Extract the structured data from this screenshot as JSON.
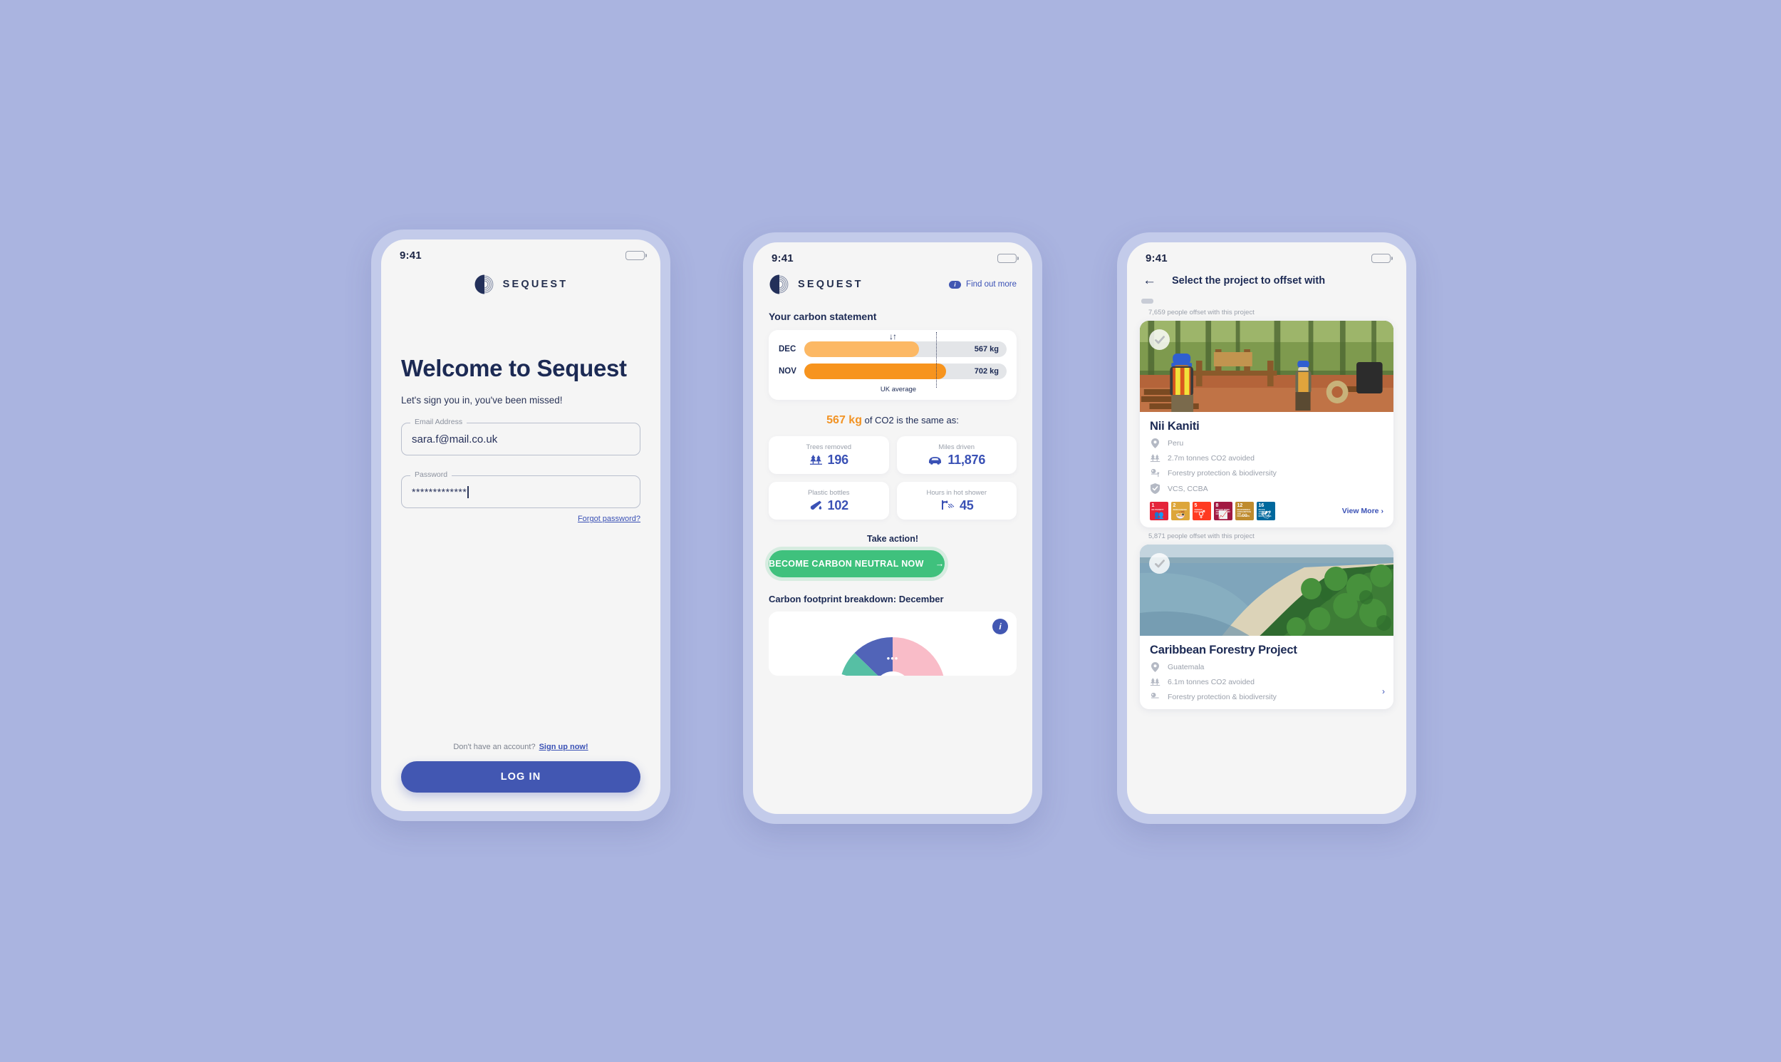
{
  "theme": {
    "background": "#aab4e0",
    "frame": "#c3cbea",
    "screen": "#f5f5f5",
    "navy": "#1c2a54",
    "blue": "#3a51b5",
    "button_blue": "#4257b2",
    "green": "#3fc17d",
    "orange_dark": "#f7941e",
    "orange_light": "#fcb864",
    "grey_track": "#e3e5e8",
    "muted": "#9aa0ab"
  },
  "brand": {
    "name": "SEQUEST"
  },
  "screen1": {
    "status": {
      "time": "9:41",
      "battery_icon": "battery-icon"
    },
    "title": "Welcome to Sequest",
    "subtitle": "Let's sign you in, you've been missed!",
    "email": {
      "label": "Email Address",
      "value": "sara.f@mail.co.uk",
      "placeholder": "Email Address"
    },
    "password": {
      "label": "Password",
      "value": "*************",
      "placeholder": "Password"
    },
    "forgot_label": "Forgot password?",
    "signup_prompt": "Don't have an account?",
    "signup_link": "Sign up now!",
    "login_label": "LOG IN"
  },
  "screen2": {
    "status": {
      "time": "9:41",
      "battery_icon": "battery-icon"
    },
    "find_out_more": "Find out more",
    "info_glyph": "i",
    "statement_title": "Your carbon statement",
    "sort_glyph": "↓↑",
    "average_label": "UK average",
    "equivalence_title_kg": "567 kg",
    "equivalence_title_rest": "of CO2 is the same as:",
    "equivalences": [
      {
        "label": "Trees removed",
        "value": "196",
        "icon": "trees-icon"
      },
      {
        "label": "Miles driven",
        "value": "11,876",
        "icon": "car-icon"
      },
      {
        "label": "Plastic bottles",
        "value": "102",
        "icon": "bottle-icon"
      },
      {
        "label": "Hours in hot shower",
        "value": "45",
        "icon": "shower-icon"
      }
    ],
    "take_action": "Take action!",
    "cta_label": "BECOME CARBON NEUTRAL NOW",
    "cta_arrow": "→",
    "breakdown_title": "Carbon footprint breakdown: December",
    "donut_dots": "•••",
    "donut_info_glyph": "i"
  },
  "screen3": {
    "status": {
      "time": "9:41",
      "battery_icon": "battery-icon"
    },
    "back_glyph": "←",
    "title": "Select the project to offset with",
    "projects": [
      {
        "people_offset": "7,659 people offset with this project",
        "name": "Nii Kaniti",
        "photo": "forest-sawmill-photo",
        "selected": true,
        "location": "Peru",
        "co2": "2.7m tonnes CO2 avoided",
        "type": "Forestry protection & biodiversity",
        "certification": "VCS, CCBA",
        "view_more": "View More",
        "view_more_chevron": "›",
        "sdgs": [
          {
            "num": "1",
            "text": "NO POVERTY",
            "color": "#e5243b",
            "glyph": "👥"
          },
          {
            "num": "2",
            "text": "ZERO HUNGER",
            "color": "#dda63a",
            "glyph": "🍜"
          },
          {
            "num": "5",
            "text": "GENDER EQUALITY",
            "color": "#ff3a21",
            "glyph": "⚥"
          },
          {
            "num": "8",
            "text": "DECENT WORK AND ECONOMIC GROWTH",
            "color": "#a21942",
            "glyph": "📈"
          },
          {
            "num": "12",
            "text": "RESPONSIBLE CONSUMPTION AND PRODUCTION",
            "color": "#bf8b2e",
            "glyph": "∞"
          },
          {
            "num": "16",
            "text": "PEACE, JUSTICE AND STRONG INSTITUTIONS",
            "color": "#00689d",
            "glyph": "🕊"
          }
        ]
      },
      {
        "people_offset": "5,871 people offset with this project",
        "name": "Caribbean Forestry Project",
        "photo": "coastline-forest-photo",
        "selected": true,
        "location": "Guatemala",
        "co2": "6.1m tonnes CO2 avoided",
        "type": "Forestry protection & biodiversity",
        "chevron": "›"
      }
    ]
  },
  "chart_data": {
    "type": "bar",
    "title": "Your carbon statement",
    "orientation": "horizontal",
    "categories": [
      "DEC",
      "NOV"
    ],
    "values": [
      567,
      702
    ],
    "value_labels": [
      "567 kg",
      "702 kg"
    ],
    "unit": "kg",
    "reference_line": {
      "label": "UK average",
      "value": 650
    },
    "xlim": [
      0,
      1000
    ],
    "colors": [
      "#fcb864",
      "#f7941e"
    ],
    "grid": false,
    "donut": {
      "type": "pie",
      "title": "Carbon footprint breakdown: December",
      "note": "half-donut, lower half cropped by screen edge",
      "slices": [
        {
          "name": "segment-pink",
          "color": "#f9bcc8",
          "value": 38
        },
        {
          "name": "segment-blue",
          "color": "#5164b8",
          "value": 27
        },
        {
          "name": "segment-teal",
          "color": "#56bfa4",
          "value": 12
        },
        {
          "name": "segment-hidden",
          "color": "#dfe2e8",
          "value": 23
        }
      ]
    }
  }
}
